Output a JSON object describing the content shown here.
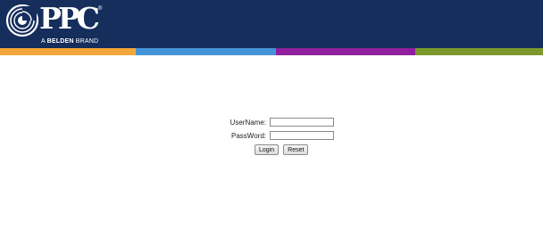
{
  "header": {
    "logo_text": "PPC",
    "logo_reg": "®",
    "tagline_prefix": "A ",
    "tagline_bold": "BELDEN",
    "tagline_suffix": " BRAND",
    "colors": {
      "background": "#152e5c",
      "stripes": [
        "#f3a73b",
        "#4494d8",
        "#8f1f9c",
        "#7c9a2c"
      ]
    }
  },
  "login": {
    "username_label": "UserName:",
    "username_value": "",
    "password_label": "PassWord:",
    "password_value": "",
    "login_button": "Login",
    "reset_button": "Reset"
  }
}
